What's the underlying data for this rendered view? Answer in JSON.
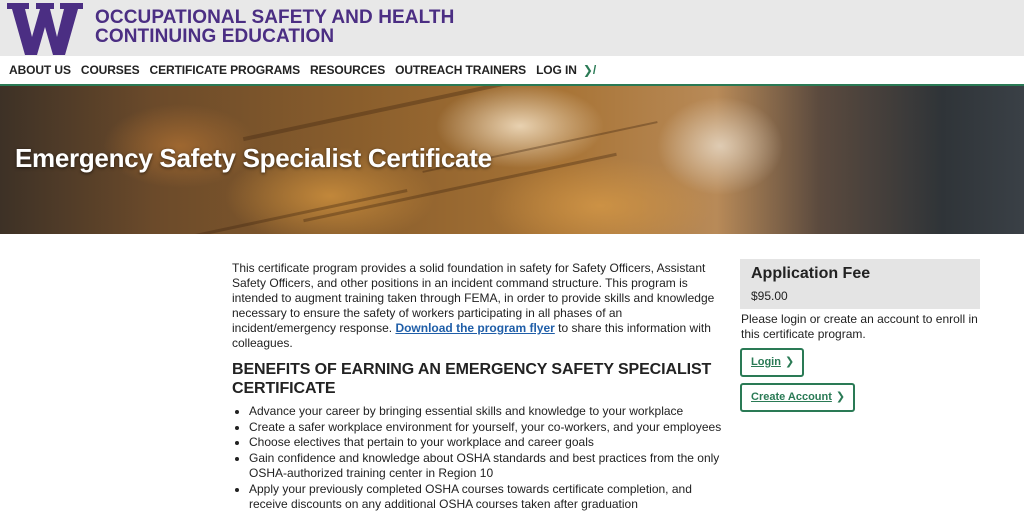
{
  "header": {
    "logo_letter": "W",
    "title_line1": "OCCUPATIONAL SAFETY AND HEALTH",
    "title_line2": "CONTINUING EDUCATION",
    "brand_color": "#4b2e83"
  },
  "nav": {
    "items": [
      "ABOUT US",
      "COURSES",
      "CERTIFICATE PROGRAMS",
      "RESOURCES",
      "OUTREACH TRAINERS",
      "LOG IN"
    ],
    "login_icon": "chevron-right-icon",
    "accent_color": "#2a7a55"
  },
  "hero": {
    "title": "Emergency Safety Specialist Certificate"
  },
  "main": {
    "intro_text": "This certificate program provides a solid foundation in safety for Safety Officers, Assistant Safety Officers, and other positions in an incident command structure. This program is intended to augment training taken through FEMA, in order to provide skills and knowledge necessary to ensure the safety of workers participating in all phases of an incident/emergency response.",
    "flyer_link": "Download the program flyer",
    "intro_tail": "to share this information with colleagues.",
    "benefits_heading": "BENEFITS OF EARNING AN EMERGENCY SAFETY SPECIALIST CERTIFICATE",
    "benefits": [
      "Advance your career by bringing essential skills and knowledge to your workplace",
      "Create a safer workplace environment for yourself, your co-workers, and your employees",
      "Choose electives that pertain to your workplace and career goals",
      "Gain confidence and knowledge about OSHA standards and best practices from the only OSHA-authorized training center in Region 10",
      "Apply your previously completed OSHA courses towards certificate completion, and receive discounts on any additional OSHA courses taken after graduation"
    ]
  },
  "aside": {
    "fee_title": "Application Fee",
    "fee_price": "$95.00",
    "note": "Please login or create an account to enroll in this certificate program.",
    "login_label": "Login",
    "create_label": "Create Account",
    "button_icon": "chevron-right-icon"
  }
}
